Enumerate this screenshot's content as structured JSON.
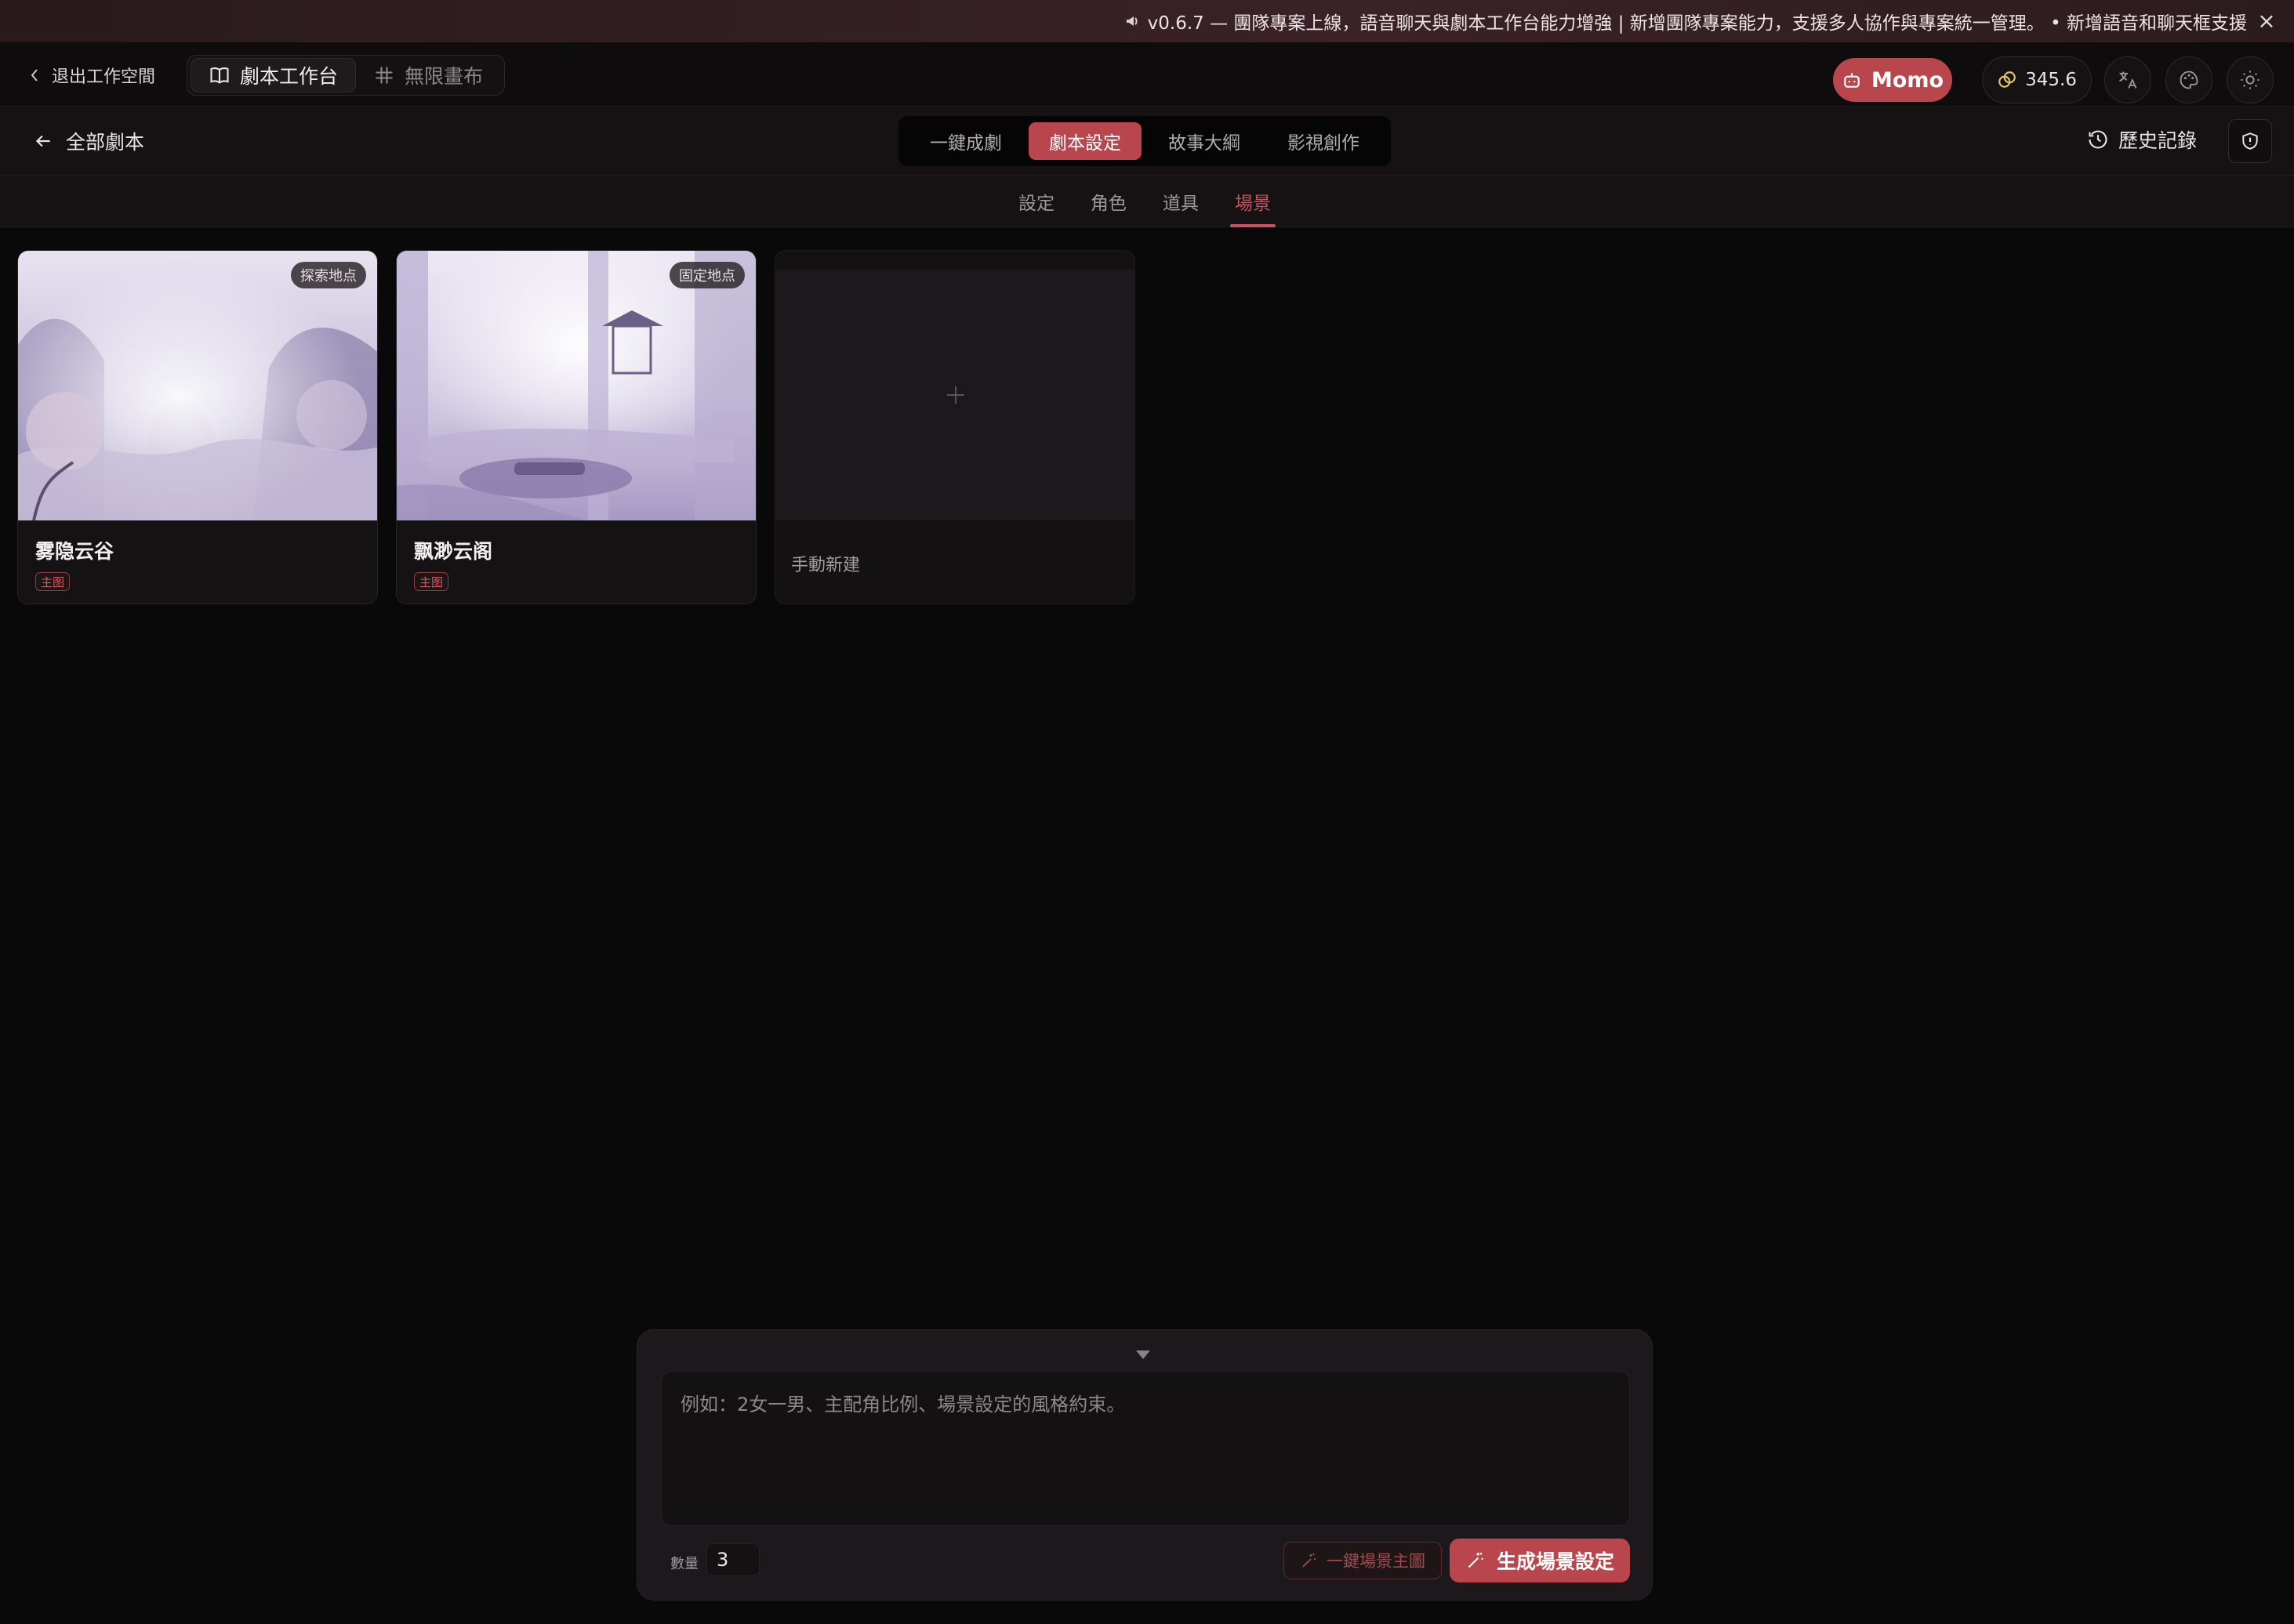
{
  "banner": {
    "text": "v0.6.7 — 團隊專案上線，語音聊天與劇本工作台能力增強 | 新增團隊專案能力，支援多人協作與專案統一管理。 • 新增語音和聊天框支援",
    "close_icon": "close-icon"
  },
  "topbar": {
    "exit_label": "退出工作空間",
    "workspace_tabs": [
      {
        "label": "劇本工作台",
        "icon": "book-icon",
        "active": true
      },
      {
        "label": "無限畫布",
        "icon": "hash-icon",
        "active": false
      }
    ],
    "momo_label": "Momo",
    "credits": "345.6"
  },
  "subbar": {
    "back_label": "全部劇本",
    "mode_tabs": [
      {
        "label": "一鍵成劇",
        "active": false
      },
      {
        "label": "劇本設定",
        "active": true
      },
      {
        "label": "故事大綱",
        "active": false
      },
      {
        "label": "影視創作",
        "active": false
      }
    ],
    "history_label": "歷史記錄"
  },
  "category_tabs": [
    {
      "label": "設定",
      "active": false
    },
    {
      "label": "角色",
      "active": false
    },
    {
      "label": "道具",
      "active": false
    },
    {
      "label": "場景",
      "active": true
    }
  ],
  "scenes": [
    {
      "title": "雾隐云谷",
      "badge": "探索地点",
      "tag": "主图"
    },
    {
      "title": "飘渺云阁",
      "badge": "固定地点",
      "tag": "主图"
    }
  ],
  "add_card": {
    "label": "手動新建"
  },
  "composer": {
    "placeholder": "例如：2女一男、主配角比例、場景設定的風格約束。",
    "quantity_label": "數量",
    "quantity_value": "3",
    "secondary_button": "一鍵場景主圖",
    "primary_button": "生成場景設定"
  },
  "colors": {
    "accent": "#b9464c",
    "background": "#0a0909"
  }
}
